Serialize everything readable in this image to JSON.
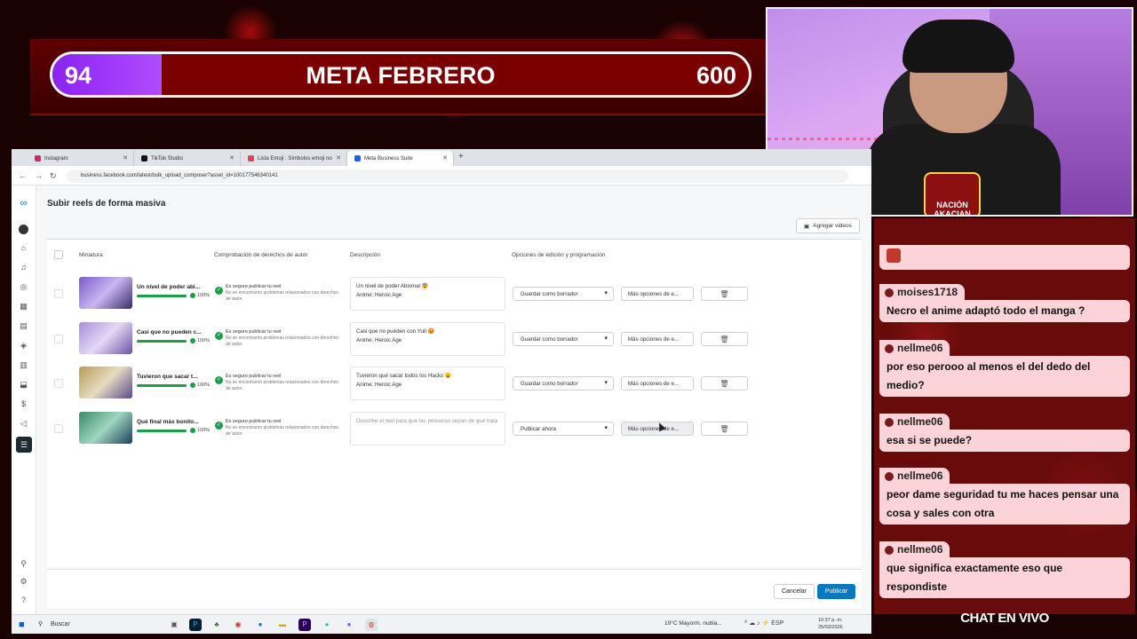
{
  "overlay": {
    "goal": {
      "current": "94",
      "title": "META FEBRERO",
      "target": "600",
      "progress_fraction": 0.157
    },
    "webcam": {
      "logo_text": "NACIÓN AKACIAN"
    },
    "chat_footer": "CHAT EN VIVO"
  },
  "chat": [
    {
      "user": "",
      "message": ""
    },
    {
      "user": "moises1718",
      "message": "Necro el anime adaptó todo el manga ?"
    },
    {
      "user": "nellme06",
      "message": "por eso perooo al menos el del dedo del medio?"
    },
    {
      "user": "nellme06",
      "message": "esa si se puede?"
    },
    {
      "user": "nellme06",
      "message": "peor dame seguridad tu me haces pensar una cosa y sales con otra"
    },
    {
      "user": "nellme06",
      "message": "que significa exactamente eso que respondiste"
    }
  ],
  "browser": {
    "tabs": [
      {
        "label": "Instagram",
        "icon": "instagram-icon",
        "color": "#d6246e"
      },
      {
        "label": "TikTok Studio",
        "icon": "tiktok-icon",
        "color": "#111111"
      },
      {
        "label": "Lista Emoji : Símbolos emoji no",
        "icon": "emoji-list-icon",
        "color": "#e4405f"
      },
      {
        "label": "Meta Business Suite",
        "icon": "meta-icon",
        "color": "#0866ff"
      }
    ],
    "url": "business.facebook.com/latest/bulk_upload_composer?asset_id=100177546340141"
  },
  "app": {
    "title": "Subir reels de forma masiva",
    "add_videos_label": "Agregar videos",
    "columns": {
      "thumbnail": "Miniatura",
      "copyright": "Comprobación de derechos de autor",
      "description": "Descripción",
      "options": "Opciones de edición y programación"
    },
    "rows": [
      {
        "name": "Un nivel de poder abi...",
        "progress": "100%",
        "copyright_title": "Es seguro publicar tu reel",
        "copyright_detail": "No se encontraron problemas relacionados con derechos de autor.",
        "description": "Un nivel de poder Abismal 😨\nAnime: Heroic Age",
        "action": "Guardar como borrador",
        "more": "Más opciones de e..."
      },
      {
        "name": "Casi que no pueden c...",
        "progress": "100%",
        "copyright_title": "Es seguro publicar tu reel",
        "copyright_detail": "No se encontraron problemas relacionados con derechos de autor.",
        "description": "Casi que no pueden con Yuti 😡\nAnime: Heroic Age",
        "action": "Guardar como borrador",
        "more": "Más opciones de e..."
      },
      {
        "name": "Tuvieron que sacar t...",
        "progress": "100%",
        "copyright_title": "Es seguro publicar tu reel",
        "copyright_detail": "No se encontraron problemas relacionados con derechos de autor.",
        "description": "Tuvieron que sacar todos los Hacks 😮\nAnime: Heroic Age",
        "action": "Guardar como borrador",
        "more": "Más opciones de e..."
      },
      {
        "name": "Qué final más bonito...",
        "progress": "100%",
        "copyright_title": "Es seguro publicar tu reel",
        "copyright_detail": "No se encontraron problemas relacionados con derechos de autor.",
        "description_placeholder": "Describe el reel para que las personas sepan de qué trata",
        "action": "Publicar ahora",
        "more": "Más opciones de e..."
      }
    ],
    "cancel_label": "Cancelar",
    "publish_label": "Publicar"
  },
  "taskbar": {
    "search_label": "Buscar",
    "weather": "19°C  Mayorm. nubla...",
    "lang": "ESP",
    "time": "10:37 p. m.",
    "date": "25/02/2026"
  }
}
